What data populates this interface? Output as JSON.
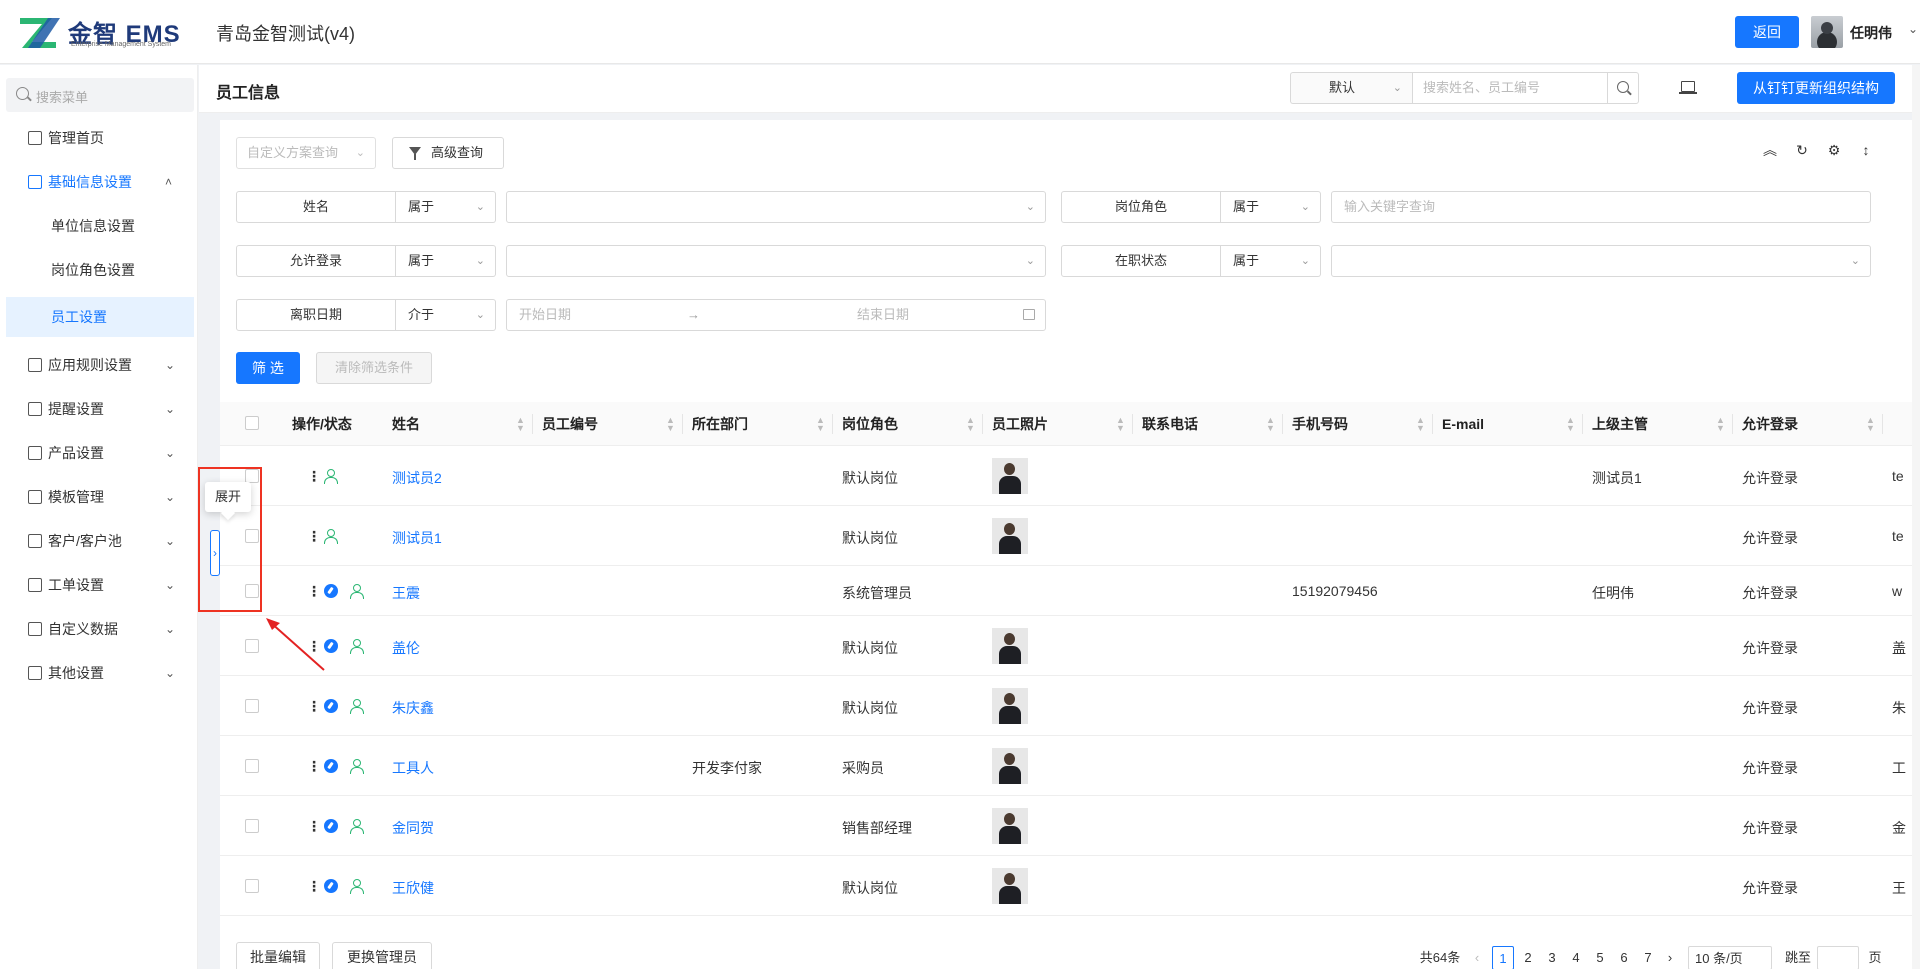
{
  "header": {
    "logo_text": "金智 EMS",
    "logo_sub": "Enterprise Management System",
    "app_title": "青岛金智测试(v4)",
    "back_label": "返回",
    "user_name": "任明伟"
  },
  "sidebar": {
    "search_placeholder": "搜索菜单",
    "items": [
      {
        "label": "管理首页",
        "icon": "home-icon"
      },
      {
        "label": "基础信息设置",
        "icon": "cube-icon"
      },
      {
        "label": "应用规则设置",
        "icon": "document-icon"
      },
      {
        "label": "提醒设置",
        "icon": "bell-icon"
      },
      {
        "label": "产品设置",
        "icon": "box-icon"
      },
      {
        "label": "模板管理",
        "icon": "template-icon"
      },
      {
        "label": "客户/客户池",
        "icon": "customer-icon"
      },
      {
        "label": "工单设置",
        "icon": "ticket-icon"
      },
      {
        "label": "自定义数据",
        "icon": "tools-icon"
      },
      {
        "label": "其他设置",
        "icon": "grid-icon"
      }
    ],
    "sub_items": [
      "单位信息设置",
      "岗位角色设置",
      "员工设置"
    ],
    "tooltip": "展开"
  },
  "page": {
    "title": "员工信息",
    "scheme_default": "默认",
    "search_placeholder": "搜索姓名、员工编号",
    "sync_button": "从钉钉更新组织结构"
  },
  "filters": {
    "scheme_placeholder": "自定义方案查询",
    "advanced_label": "高级查询",
    "rows": [
      {
        "label": "姓名",
        "op": "属于",
        "value": ""
      },
      {
        "label": "岗位角色",
        "op": "属于",
        "value_placeholder": "输入关键字查询"
      },
      {
        "label": "允许登录",
        "op": "属于",
        "value": ""
      },
      {
        "label": "在职状态",
        "op": "属于",
        "value": ""
      },
      {
        "label": "离职日期",
        "op": "介于",
        "start_placeholder": "开始日期",
        "end_placeholder": "结束日期"
      }
    ],
    "filter_button": "筛 选",
    "clear_button": "清除筛选条件"
  },
  "table": {
    "columns": [
      "操作/状态",
      "姓名",
      "员工编号",
      "所在部门",
      "岗位角色",
      "员工照片",
      "联系电话",
      "手机号码",
      "E-mail",
      "上级主管",
      "允许登录"
    ],
    "rows": [
      {
        "name": "测试员2",
        "dept": "",
        "role": "默认岗位",
        "photo": true,
        "mobile": "",
        "manager": "测试员1",
        "login": "允许登录",
        "extra": "te",
        "status_icon": false
      },
      {
        "name": "测试员1",
        "dept": "",
        "role": "默认岗位",
        "photo": true,
        "mobile": "",
        "manager": "",
        "login": "允许登录",
        "extra": "te",
        "status_icon": false
      },
      {
        "name": "王震",
        "dept": "",
        "role": "系统管理员",
        "photo": false,
        "mobile": "15192079456",
        "manager": "任明伟",
        "login": "允许登录",
        "extra": "w",
        "status_icon": true
      },
      {
        "name": "盖伦",
        "dept": "",
        "role": "默认岗位",
        "photo": true,
        "mobile": "",
        "manager": "",
        "login": "允许登录",
        "extra": "盖",
        "status_icon": true
      },
      {
        "name": "朱庆鑫",
        "dept": "",
        "role": "默认岗位",
        "photo": true,
        "mobile": "",
        "manager": "",
        "login": "允许登录",
        "extra": "朱",
        "status_icon": true
      },
      {
        "name": "工具人",
        "dept": "开发李付家",
        "role": "采购员",
        "photo": true,
        "mobile": "",
        "manager": "",
        "login": "允许登录",
        "extra": "工",
        "status_icon": true
      },
      {
        "name": "金同贺",
        "dept": "",
        "role": "销售部经理",
        "photo": true,
        "mobile": "",
        "manager": "",
        "login": "允许登录",
        "extra": "金",
        "status_icon": true
      },
      {
        "name": "王欣健",
        "dept": "",
        "role": "默认岗位",
        "photo": true,
        "mobile": "",
        "manager": "",
        "login": "允许登录",
        "extra": "王",
        "status_icon": true
      }
    ]
  },
  "footer": {
    "bulk_edit": "批量编辑",
    "change_admin": "更换管理员",
    "total": "共64条",
    "pages": [
      "1",
      "2",
      "3",
      "4",
      "5",
      "6",
      "7"
    ],
    "current_page": "1",
    "page_size": "10 条/页",
    "jump_label": "跳至",
    "page_unit": "页"
  },
  "colors": {
    "primary": "#1677ff",
    "status_green": "#2bb673",
    "highlight_red": "#e32222"
  }
}
